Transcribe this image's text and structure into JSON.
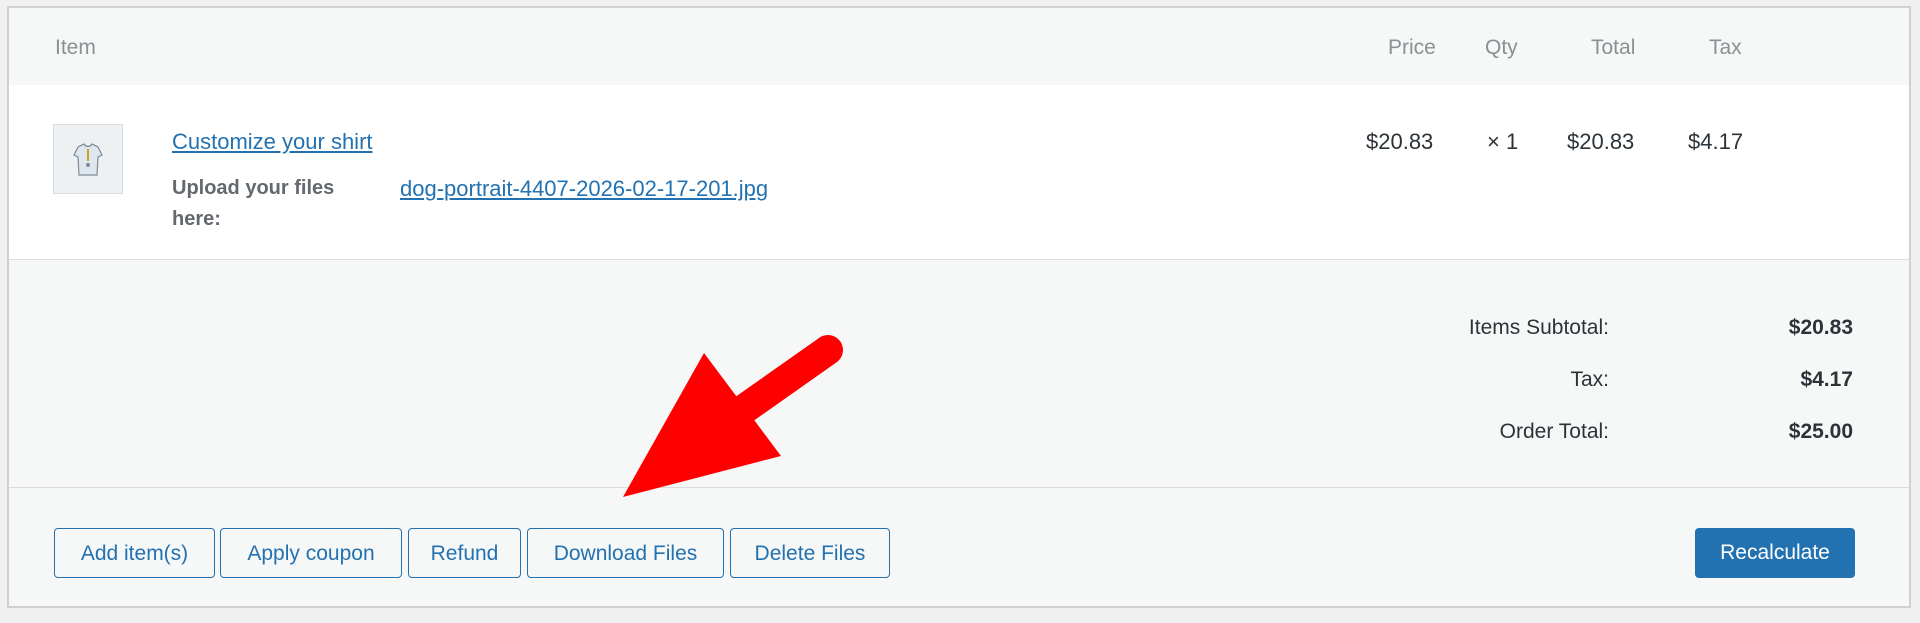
{
  "header": {
    "item": "Item",
    "price": "Price",
    "qty": "Qty",
    "total": "Total",
    "tax": "Tax"
  },
  "line_item": {
    "name": "Customize your shirt",
    "thumbnail_icon": "shirt-thumbnail-icon",
    "meta_key": "Upload your files here:",
    "meta_value": "dog-portrait-4407-2026-02-17-201.jpg",
    "price": "$20.83",
    "qty": "× 1",
    "total": "$20.83",
    "tax": "$4.17"
  },
  "totals": {
    "subtotal_label": "Items Subtotal:",
    "subtotal_value": "$20.83",
    "tax_label": "Tax:",
    "tax_value": "$4.17",
    "order_total_label": "Order Total:",
    "order_total_value": "$25.00"
  },
  "actions": {
    "add_items": "Add item(s)",
    "apply_coupon": "Apply coupon",
    "refund": "Refund",
    "download_files": "Download Files",
    "delete_files": "Delete Files",
    "recalculate": "Recalculate"
  },
  "colors": {
    "accent": "#2271b1",
    "annotation_arrow": "#ff0000"
  }
}
